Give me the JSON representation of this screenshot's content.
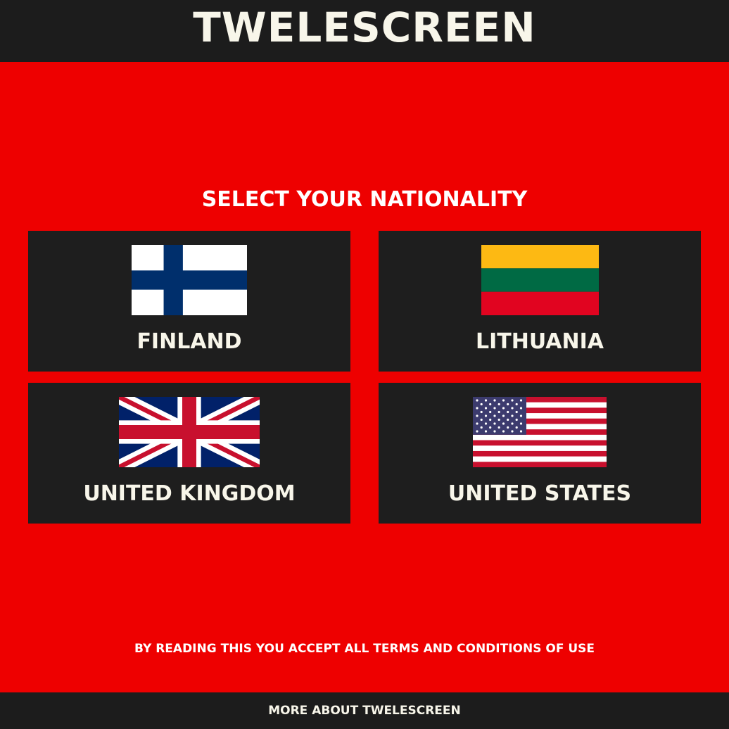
{
  "header": {
    "brand": "TWELESCREEN"
  },
  "main": {
    "heading": "SELECT YOUR NATIONALITY",
    "options": [
      {
        "label": "FINLAND",
        "flag": "finland-flag-icon"
      },
      {
        "label": "LITHUANIA",
        "flag": "lithuania-flag-icon"
      },
      {
        "label": "UNITED KINGDOM",
        "flag": "united-kingdom-flag-icon"
      },
      {
        "label": "UNITED STATES",
        "flag": "united-states-flag-icon"
      }
    ],
    "terms": "BY READING THIS YOU ACCEPT ALL TERMS AND CONDITIONS OF USE"
  },
  "footer": {
    "link": "MORE ABOUT TWELESCREEN"
  },
  "colors": {
    "background": "#ee0000",
    "bar": "#1c1c1c",
    "card": "#1e1e1e",
    "text": "#f8f6ea"
  }
}
